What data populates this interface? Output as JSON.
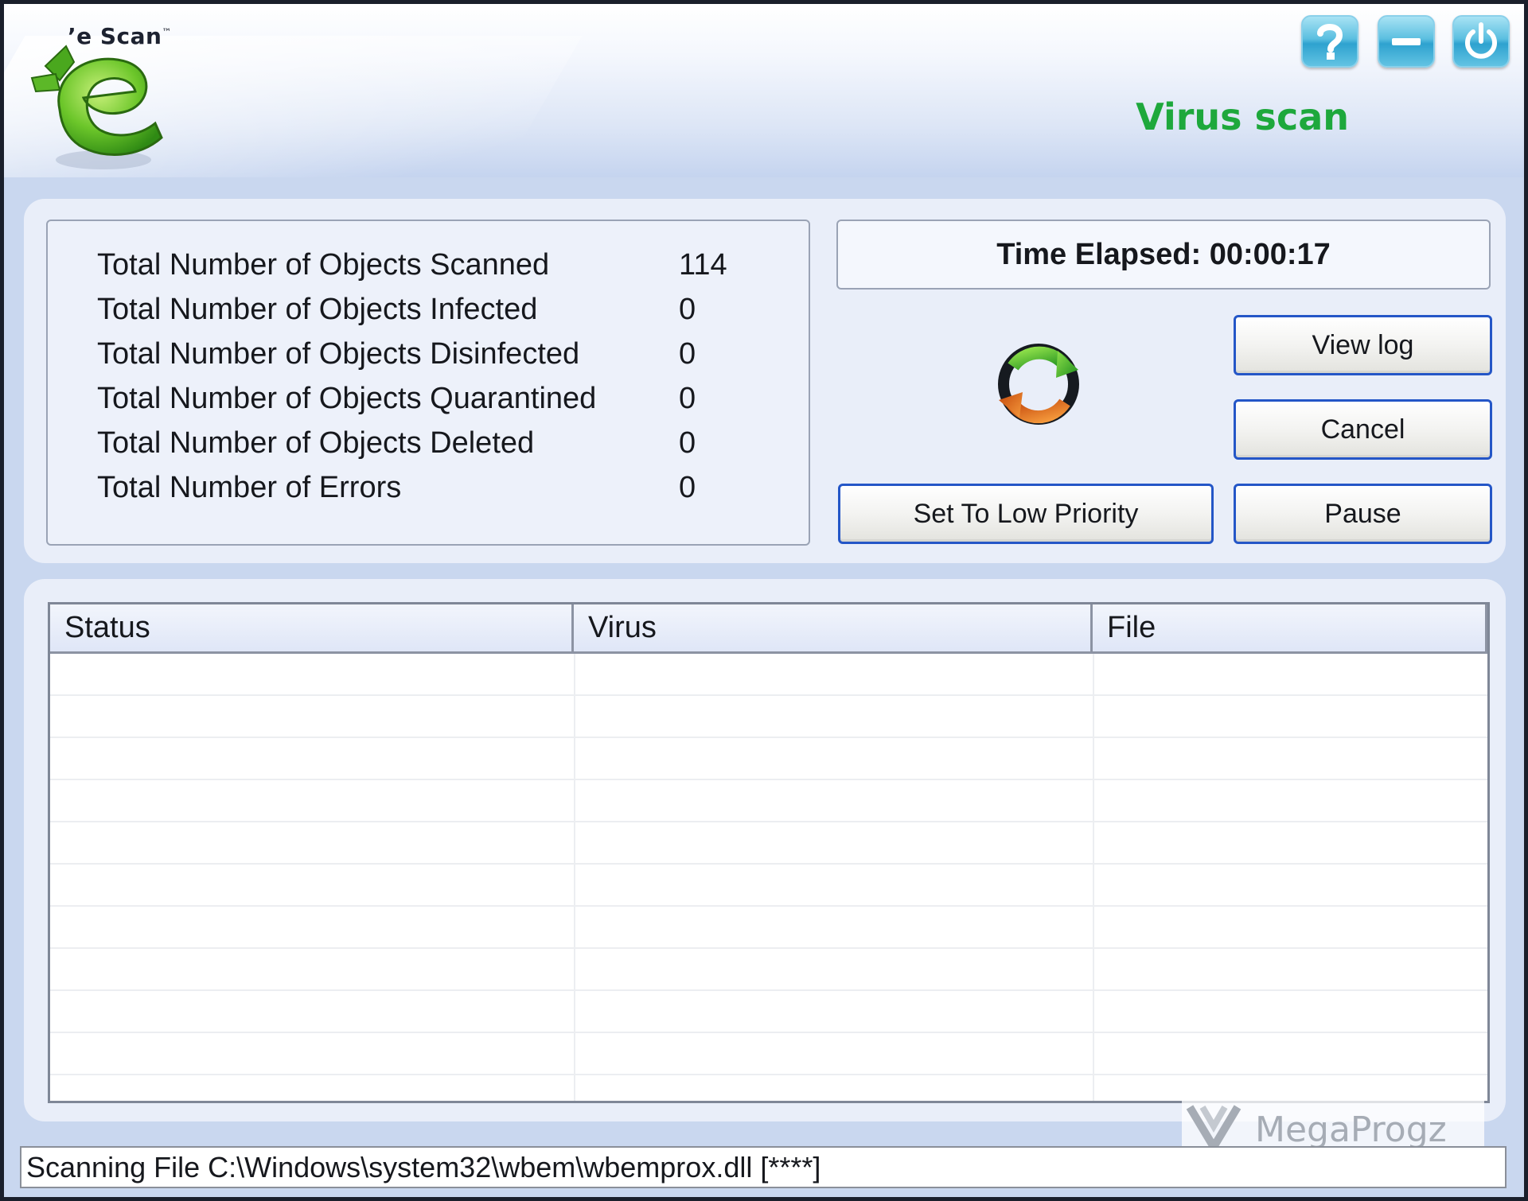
{
  "header": {
    "logo_text": "e Scan",
    "logo_tm": "™",
    "title": "Virus scan",
    "help_icon": "question-mark-icon",
    "minimize_icon": "minimize-icon",
    "power_icon": "power-icon"
  },
  "stats": [
    {
      "label": "Total Number of Objects Scanned",
      "value": "114"
    },
    {
      "label": "Total Number of Objects Infected",
      "value": "0"
    },
    {
      "label": "Total Number of Objects Disinfected",
      "value": "0"
    },
    {
      "label": "Total Number of Objects Quarantined",
      "value": "0"
    },
    {
      "label": "Total Number of Objects Deleted",
      "value": "0"
    },
    {
      "label": "Total Number of Errors",
      "value": "0"
    }
  ],
  "time_elapsed": "Time Elapsed: 00:00:17",
  "buttons": {
    "view_log": "View log",
    "cancel": "Cancel",
    "pause": "Pause",
    "low_priority": "Set To Low Priority"
  },
  "table": {
    "columns": [
      "Status",
      "Virus",
      "File"
    ],
    "rows": []
  },
  "status_bar": "Scanning File C:\\Windows\\system32\\wbem\\wbemprox.dll [****]",
  "watermark": "MegaProgz",
  "colors": {
    "accent_green": "#1ea83c",
    "button_border": "#2456c7",
    "panel_bg": "#e9eef9",
    "window_bg": "#c9d7ef"
  }
}
